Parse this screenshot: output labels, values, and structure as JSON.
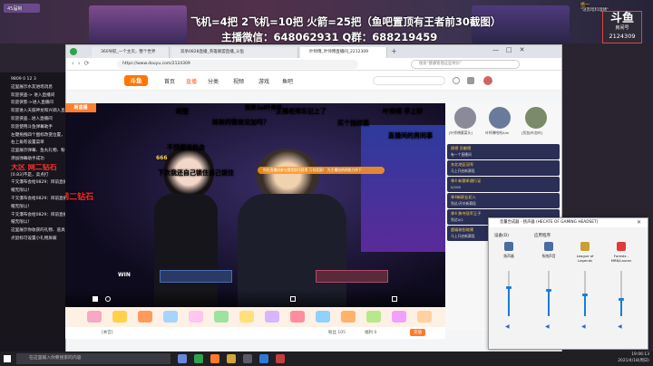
{
  "top_banner": {
    "line1": "飞机=4把 2飞机=10把 火箭=25把（鱼吧置顶有王者前30截图）",
    "line2": "主播微信：648062931   Q群：688219459",
    "left_badge": "45届制",
    "right_notice1": "悟一",
    "right_notice2": "\"谜黑暗料理嗜\""
  },
  "logo": {
    "brand": "斗鱼",
    "sub": "房间号",
    "room": "2124309"
  },
  "left_chat": [
    "9809  0  12  3",
    "这里展示水友进场消息",
    "欢迎侠盗->  进入直播间",
    "欢迎侠客->进入直播间",
    "欢迎进入天鼓神龙和兴调入直播间",
    "欢迎侠盗...进入直播间",
    "",
    "欢迎使用斗鱼弹幕助手",
    "左键拖拽四个图标改变位置，右键拖拽改变大小",
    "右上角有设置菜单",
    "这里展示弹幕、鱼丸礼物、粉丝牌升级等",
    "添加弹幕助手成功",
    "大区  网二钻石",
    "[0.83]不是，卖点打",
    "千叉瀑布会给0829：目前直播中     飞机可以上直播！",
    "        帽无限以！",
    "千叉瀑布会给0829：目前直播中     飞机可以上直播！",
    "        帽无限以！",
    "千叉瀑布会给0829：目前直播中     飞机可以上直播！",
    "        帽无限以！",
    "这里展示你收获的礼物、道具",
    "点鼠标可设置小礼物屏蔽"
  ],
  "browser": {
    "tabs": [
      "360导航_一个主页，整个世界",
      "双杀0828直播_英雄联盟直播_斗鱼",
      "叶师傅_叶师傅直播间_2212309"
    ],
    "url": "https://www.douyu.com/2124309",
    "search_placeholder": "搜索\"健康管理这些特异\"",
    "nav_home": "首页",
    "nav_live": "直播",
    "nav_category": "分类",
    "nav_video": "视频",
    "nav_game": "游戏",
    "nav_fishbar": "鱼吧",
    "site_logo": "斗鱼"
  },
  "video": {
    "danmaku": [
      {
        "text": "结整",
        "color": "#ffffff"
      },
      {
        "text": "微博:lol叶师傅",
        "color": "#ffffff"
      },
      {
        "text": "主播老师忘记上了",
        "color": "#ffe34d"
      },
      {
        "text": "叶师傅 早上好",
        "color": "#ffffff"
      },
      {
        "text": "妹妹的微信没加吗？",
        "color": "#b18bff"
      },
      {
        "text": "买个指纹锁",
        "color": "#35d0ff"
      },
      {
        "text": "直播间的男同事",
        "color": "#ffffff"
      },
      {
        "text": "不然都没机会",
        "color": "#ffffff"
      },
      {
        "text": "下次我还自己锁住自己锁住",
        "color": "#ffffff"
      },
      {
        "text": "主播给哪个小可爱？",
        "color": "#ffffff"
      },
      {
        "text": "大区  网二钻石",
        "color": "#ff3030"
      }
    ],
    "notice": "你在直播间参与猜竞即可获得 万份奖励！  为主播加热闹热力作下",
    "overlay_left": "新直播",
    "overlay_count": "666",
    "win_label": "WIN"
  },
  "bottom_bar": {
    "text1": "[本宫]",
    "text2": "粉丝 105",
    "text3": "福利 0",
    "btn": "充值"
  },
  "right_panel": {
    "top_names": [
      "[叶师傅黄菜头]",
      "叶师傅哈哈Aim",
      "[伏加/叶加叶]"
    ],
    "top_scores": [
      "1",
      "2",
      "3"
    ],
    "items": [
      {
        "title": "周榜 贡献榜",
        "sub": "有一个直播间"
      },
      {
        "title": "东北地区冠军",
        "sub": "马上开启新赛段"
      },
      {
        "title": "季4 新赛季通行证",
        "sub": "0/100"
      },
      {
        "title": "季4新职业初入",
        "sub": "到达/开关新赛段"
      },
      {
        "title": "季4 勇夺冠军王子",
        "sub": "到达0/2"
      },
      {
        "title": "超级装扮效果",
        "sub": "马上开启新赛段"
      }
    ]
  },
  "sound_mixer": {
    "title": "音量合成器 - 扬声器 (HECATE OF GAMING HEADSET)",
    "device_label": "设备(D)",
    "apps_label": "应用程序",
    "channels": [
      {
        "name": "扬声器",
        "level": 0.6
      },
      {
        "name": "系统声音",
        "level": 0.55
      },
      {
        "name": "League of Legends",
        "level": 0.45
      },
      {
        "name": "Forests - MRB/Lauren Hu...",
        "level": 0.35
      }
    ]
  },
  "taskbar": {
    "search_placeholder": "在这里输入你要搜索的内容",
    "time": "19:06:13",
    "date": "2021/4/18(周日)"
  }
}
